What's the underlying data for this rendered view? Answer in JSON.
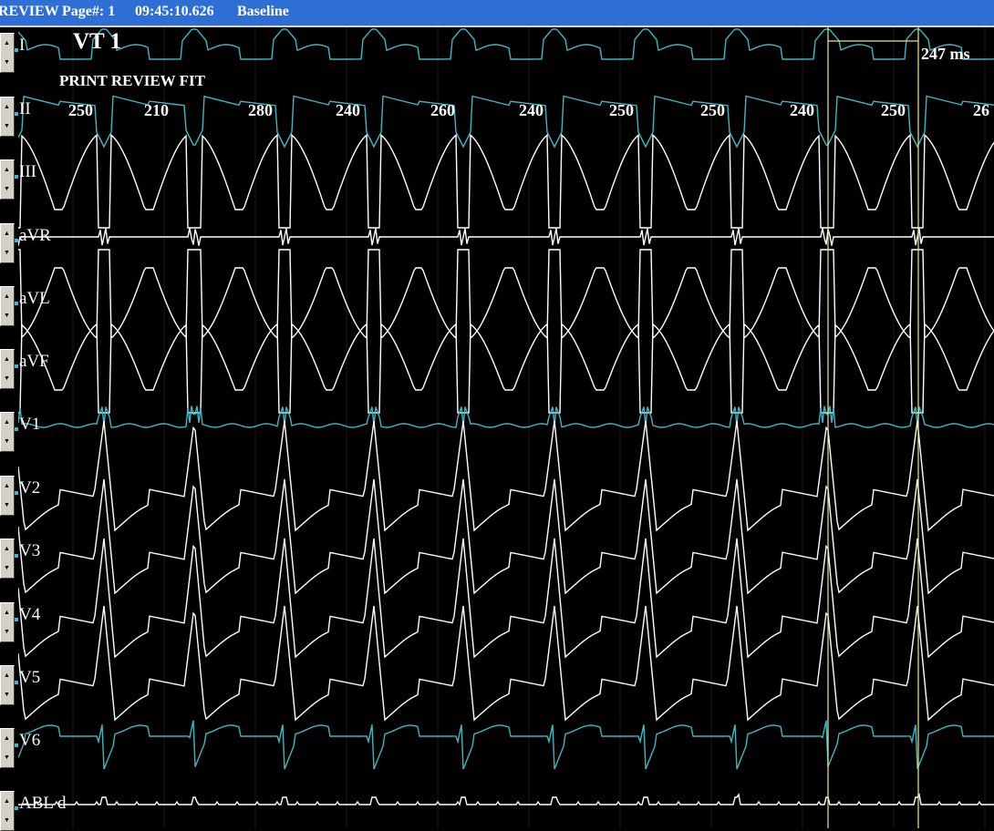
{
  "titlebar": {
    "mode": "REVIEW",
    "page_label": "Page#: 1",
    "time": "09:45:10.626",
    "state": "Baseline"
  },
  "overlay": {
    "title": "VT 1",
    "subtitle": "PRINT REVIEW FIT",
    "measurement": "247 ms"
  },
  "cycle_lengths": [
    "250",
    "210",
    "280",
    "240",
    "260",
    "240",
    "250",
    "250",
    "240",
    "250",
    "26"
  ],
  "channels": [
    {
      "label": "I",
      "color": "#3bb8c4"
    },
    {
      "label": "II",
      "color": "#3bb8c4"
    },
    {
      "label": "III",
      "color": "#ffffff"
    },
    {
      "label": "aVR",
      "color": "#ffffff"
    },
    {
      "label": "aVL",
      "color": "#ffffff"
    },
    {
      "label": "aVF",
      "color": "#ffffff"
    },
    {
      "label": "V1",
      "color": "#3bb8c4"
    },
    {
      "label": "V2",
      "color": "#ffffff"
    },
    {
      "label": "V3",
      "color": "#ffffff"
    },
    {
      "label": "V4",
      "color": "#ffffff"
    },
    {
      "label": "V5",
      "color": "#ffffff"
    },
    {
      "label": "V6",
      "color": "#3bb8c4"
    },
    {
      "label": "ABL d",
      "color": "#ffffff"
    }
  ],
  "colors": {
    "background": "#000000",
    "titlebar": "#2e6fd6",
    "cyan_trace": "#3bb8c4",
    "white_trace": "#ffffff",
    "caliper": "#e8e88a"
  }
}
